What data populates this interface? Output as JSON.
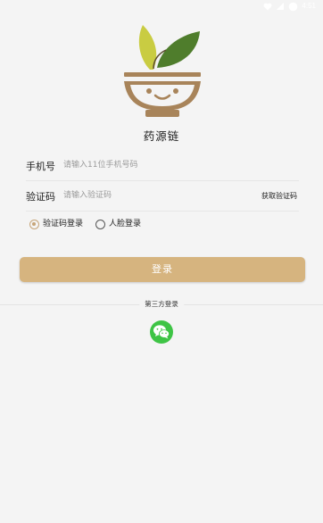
{
  "status_bar": {
    "time": "4:51",
    "icons": [
      "heart-icon",
      "signal-icon",
      "battery-icon"
    ]
  },
  "app": {
    "name": "药源链",
    "logo": "herb-bowl-logo"
  },
  "form": {
    "phone_label": "手机号",
    "phone_placeholder": "请输入11位手机号码",
    "phone_value": "",
    "code_label": "验证码",
    "code_placeholder": "请输入验证码",
    "code_value": "",
    "get_code_label": "获取验证码"
  },
  "login_modes": [
    {
      "label": "验证码登录",
      "selected": true
    },
    {
      "label": "人脸登录",
      "selected": false
    }
  ],
  "login_button": "登录",
  "third_party": {
    "label": "第三方登录",
    "providers": [
      "wechat-icon"
    ]
  },
  "colors": {
    "accent": "#d6b47f",
    "radio_selected": "#c7a579",
    "wechat": "#3ec445",
    "background": "#f4f4f4"
  }
}
